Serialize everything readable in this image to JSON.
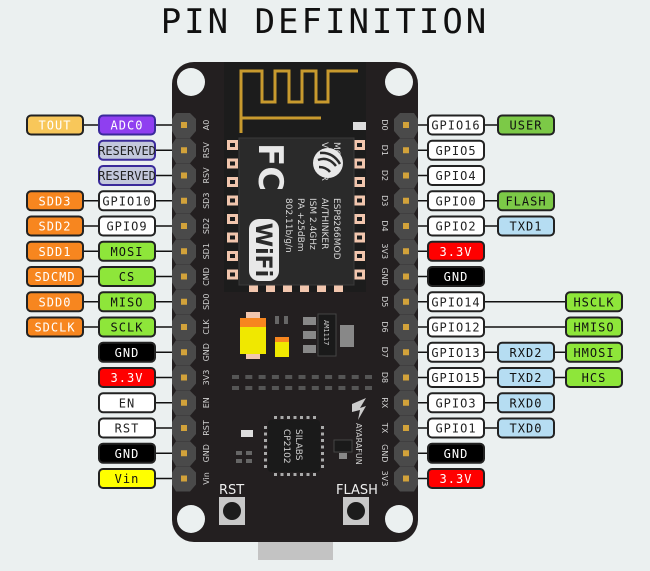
{
  "title": "PIN DEFINITION",
  "colors": {
    "background": "#ebf0f0",
    "board": "#231f20",
    "header": "#4a4a4a",
    "pin": "#d2a23a",
    "antenna": "#c89a2e",
    "pad": "#f2c6ae",
    "module": "#2a2a2a",
    "orange": "#f7861f",
    "light_orange": "#f8c75a",
    "purple": "#8f3ff0",
    "reserved": "#c3c8dc",
    "white": "#ffffff",
    "green": "#8ee63a",
    "flash_green": "#7cc947",
    "blue": "#b6ddf2",
    "red": "#ff0000",
    "black": "#000000",
    "yellow": "#ffff00",
    "silk": "#d0d0d0"
  },
  "left_pins": [
    {
      "silk": "A0",
      "labels": [
        {
          "text": "ADC0",
          "style": "purple"
        },
        {
          "text": "TOUT",
          "style": "light_orange"
        }
      ]
    },
    {
      "silk": "RSV",
      "labels": [
        {
          "text": "RESERVED",
          "style": "reserved"
        }
      ]
    },
    {
      "silk": "RSV",
      "labels": [
        {
          "text": "RESERVED",
          "style": "reserved"
        }
      ]
    },
    {
      "silk": "SD3",
      "labels": [
        {
          "text": "GPIO10",
          "style": "white"
        },
        {
          "text": "SDD3",
          "style": "orange"
        }
      ]
    },
    {
      "silk": "SD2",
      "labels": [
        {
          "text": "GPIO9",
          "style": "white"
        },
        {
          "text": "SDD2",
          "style": "orange"
        }
      ]
    },
    {
      "silk": "SD1",
      "labels": [
        {
          "text": "MOSI",
          "style": "green"
        },
        {
          "text": "SDD1",
          "style": "orange"
        }
      ]
    },
    {
      "silk": "CMD",
      "labels": [
        {
          "text": "CS",
          "style": "green"
        },
        {
          "text": "SDCMD",
          "style": "orange"
        }
      ]
    },
    {
      "silk": "SD0",
      "labels": [
        {
          "text": "MISO",
          "style": "green"
        },
        {
          "text": "SDD0",
          "style": "orange"
        }
      ]
    },
    {
      "silk": "CLK",
      "labels": [
        {
          "text": "SCLK",
          "style": "green"
        },
        {
          "text": "SDCLK",
          "style": "orange"
        }
      ]
    },
    {
      "silk": "GND",
      "labels": [
        {
          "text": "GND",
          "style": "black"
        }
      ]
    },
    {
      "silk": "3V3",
      "labels": [
        {
          "text": "3.3V",
          "style": "red"
        }
      ]
    },
    {
      "silk": "EN",
      "labels": [
        {
          "text": "EN",
          "style": "white"
        }
      ]
    },
    {
      "silk": "RST",
      "labels": [
        {
          "text": "RST",
          "style": "white"
        }
      ]
    },
    {
      "silk": "GND",
      "labels": [
        {
          "text": "GND",
          "style": "black"
        }
      ]
    },
    {
      "silk": "Vin",
      "labels": [
        {
          "text": "Vin",
          "style": "yellow"
        }
      ]
    }
  ],
  "right_pins": [
    {
      "silk": "D0",
      "labels": [
        {
          "text": "GPIO16",
          "style": "white",
          "col": 0
        },
        {
          "text": "USER",
          "style": "flash_green",
          "col": 1
        }
      ]
    },
    {
      "silk": "D1",
      "labels": [
        {
          "text": "GPIO5",
          "style": "white",
          "col": 0
        }
      ]
    },
    {
      "silk": "D2",
      "labels": [
        {
          "text": "GPIO4",
          "style": "white",
          "col": 0
        }
      ]
    },
    {
      "silk": "D3",
      "labels": [
        {
          "text": "GPIO0",
          "style": "white",
          "col": 0
        },
        {
          "text": "FLASH",
          "style": "flash_green",
          "col": 1
        }
      ]
    },
    {
      "silk": "D4",
      "labels": [
        {
          "text": "GPIO2",
          "style": "white",
          "col": 0
        },
        {
          "text": "TXD1",
          "style": "blue",
          "col": 1
        }
      ]
    },
    {
      "silk": "3V3",
      "labels": [
        {
          "text": "3.3V",
          "style": "red",
          "col": 0
        }
      ]
    },
    {
      "silk": "GND",
      "labels": [
        {
          "text": "GND",
          "style": "black",
          "col": 0
        }
      ]
    },
    {
      "silk": "D5",
      "labels": [
        {
          "text": "GPIO14",
          "style": "white",
          "col": 0
        },
        {
          "text": "HSCLK",
          "style": "green",
          "col": 2
        }
      ]
    },
    {
      "silk": "D6",
      "labels": [
        {
          "text": "GPIO12",
          "style": "white",
          "col": 0
        },
        {
          "text": "HMISO",
          "style": "green",
          "col": 2
        }
      ]
    },
    {
      "silk": "D7",
      "labels": [
        {
          "text": "GPIO13",
          "style": "white",
          "col": 0
        },
        {
          "text": "RXD2",
          "style": "blue",
          "col": 1
        },
        {
          "text": "HMOSI",
          "style": "green",
          "col": 2
        }
      ]
    },
    {
      "silk": "D8",
      "labels": [
        {
          "text": "GPIO15",
          "style": "white",
          "col": 0
        },
        {
          "text": "TXD2",
          "style": "blue",
          "col": 1
        },
        {
          "text": "HCS",
          "style": "green",
          "col": 2
        }
      ]
    },
    {
      "silk": "RX",
      "labels": [
        {
          "text": "GPIO3",
          "style": "white",
          "col": 0
        },
        {
          "text": "RXD0",
          "style": "blue",
          "col": 1
        }
      ]
    },
    {
      "silk": "TX",
      "labels": [
        {
          "text": "GPIO1",
          "style": "white",
          "col": 0
        },
        {
          "text": "TXD0",
          "style": "blue",
          "col": 1
        }
      ]
    },
    {
      "silk": "GND",
      "labels": [
        {
          "text": "GND",
          "style": "black",
          "col": 0
        }
      ]
    },
    {
      "silk": "3V3",
      "labels": [
        {
          "text": "3.3V",
          "style": "red",
          "col": 0
        }
      ]
    }
  ],
  "module": {
    "lines": [
      "MODEL",
      "VENDOR",
      "ISM 2.4GHz",
      "PA +25dBm",
      "802.11b/g/n"
    ],
    "values": [
      "ESP8266MOD",
      "AI/THINKER"
    ],
    "fc_logo": "FC",
    "wifi_logo": "WiFi"
  },
  "ic_main": [
    "SILABS",
    "CP2102"
  ],
  "regulator": "AM1117",
  "brand": "AYARAFUN",
  "buttons": [
    {
      "label": "RST"
    },
    {
      "label": "FLASH"
    }
  ]
}
